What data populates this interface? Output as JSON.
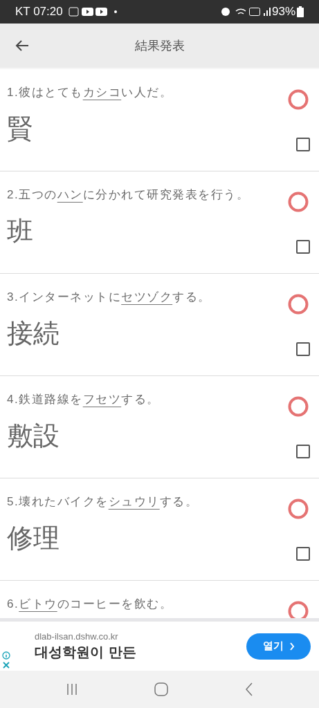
{
  "status_bar": {
    "carrier_time": "KT 07:20",
    "battery": "93%"
  },
  "header": {
    "title": "結果発表"
  },
  "questions": [
    {
      "number": "1.",
      "before": "彼はとても",
      "target": "カシコ",
      "after": "い人だ。",
      "answer": "賢",
      "correct": true,
      "checked": false
    },
    {
      "number": "2.",
      "before": "五つの",
      "target": "ハン",
      "after": "に分かれて研究発表を行う。",
      "answer": "班",
      "correct": true,
      "checked": false
    },
    {
      "number": "3.",
      "before": "インターネットに",
      "target": "セツゾク",
      "after": "する。",
      "answer": "接続",
      "correct": true,
      "checked": false
    },
    {
      "number": "4.",
      "before": "鉄道路線を",
      "target": "フセツ",
      "after": "する。",
      "answer": "敷設",
      "correct": true,
      "checked": false
    },
    {
      "number": "5.",
      "before": "壊れたバイクを",
      "target": "シュウリ",
      "after": "する。",
      "answer": "修理",
      "correct": true,
      "checked": false
    },
    {
      "number": "6.",
      "target": "ビトウ",
      "after": "のコーヒーを飲む。",
      "correct": true
    }
  ],
  "ad": {
    "url": "dlab-ilsan.dshw.co.kr",
    "headline": "대성학원이 만든",
    "button": "열기"
  }
}
